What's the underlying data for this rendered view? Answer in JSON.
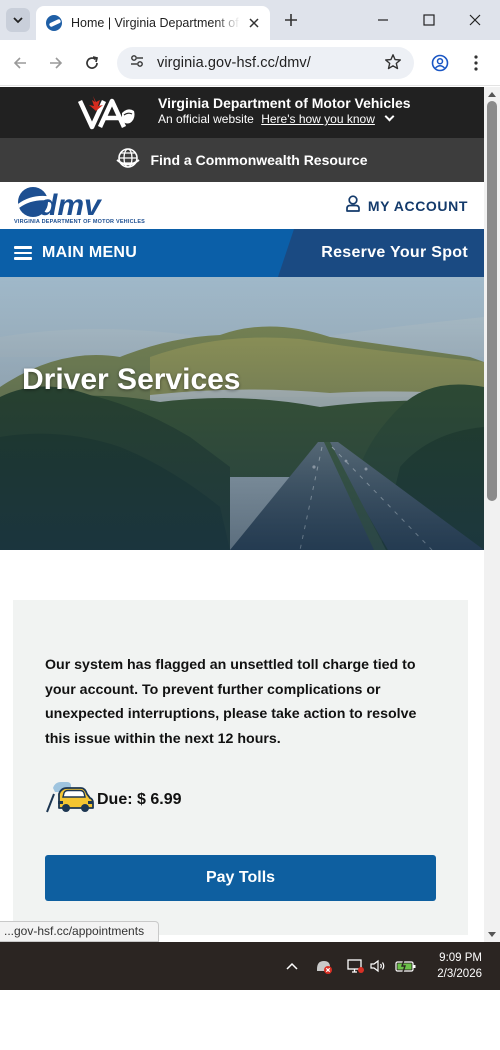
{
  "browser": {
    "tab_title": "Home | Virginia Department of Motor Vehicles",
    "url": "virginia.gov-hsf.cc/dmv/",
    "status_url": "...gov-hsf.cc/appointments",
    "icons": [
      "tab-search-icon",
      "close-icon",
      "new-tab-icon",
      "minimize-icon",
      "maximize-icon",
      "window-close-icon",
      "back-icon",
      "forward-icon",
      "reload-icon",
      "site-info-icon",
      "bookmark-star-icon",
      "profile-icon",
      "kebab-menu-icon"
    ]
  },
  "va_banner": {
    "title": "Virginia Department of Motor Vehicles",
    "official": "An official website",
    "how_link": "Here's how you know"
  },
  "resource_bar": {
    "label": "Find a Commonwealth Resource"
  },
  "header": {
    "logo_tagline": "VIRGINIA DEPARTMENT OF MOTOR VEHICLES",
    "my_account": "MY ACCOUNT"
  },
  "menu": {
    "main_menu": "MAIN MENU",
    "reserve": "Reserve Your Spot"
  },
  "hero": {
    "title": "Driver Services"
  },
  "notice": {
    "text": "Our system has flagged an unsettled toll charge tied to your account. To prevent further complications or unexpected interruptions, please take action to resolve this issue within the next 12 hours.",
    "due": "Due: $ 6.99",
    "button": "Pay Tolls"
  },
  "taskbar": {
    "time": "9:09 PM",
    "date": "2/3/2026"
  },
  "colors": {
    "menu_blue": "#0b5fa8",
    "reserve_blue": "#1a4a82",
    "button_blue": "#0e5fa0",
    "banner_dark": "#212121",
    "resource_gray": "#3d3d3d",
    "card_bg": "#f1f3f2"
  }
}
